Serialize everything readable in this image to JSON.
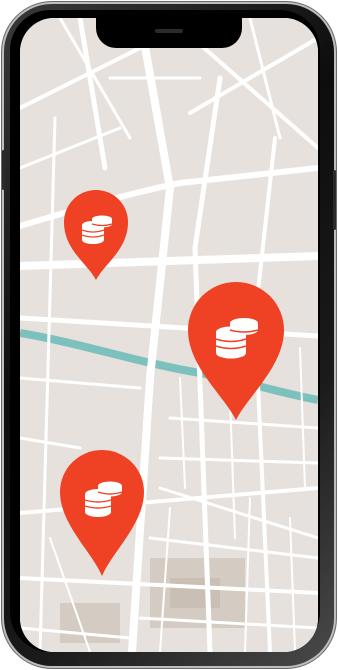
{
  "device": {
    "type": "smartphone",
    "frame_color": "#1a1a1a"
  },
  "map": {
    "background_color": "#e6e1dc",
    "road_color": "#ffffff",
    "block_color": "#ddd7d0",
    "river_color": "#7cc1bd"
  },
  "pins": [
    {
      "id": "pin-1",
      "icon": "coins-icon",
      "color": "#ef4123"
    },
    {
      "id": "pin-2",
      "icon": "coins-icon",
      "color": "#ef4123"
    },
    {
      "id": "pin-3",
      "icon": "coins-icon",
      "color": "#ef4123"
    }
  ]
}
